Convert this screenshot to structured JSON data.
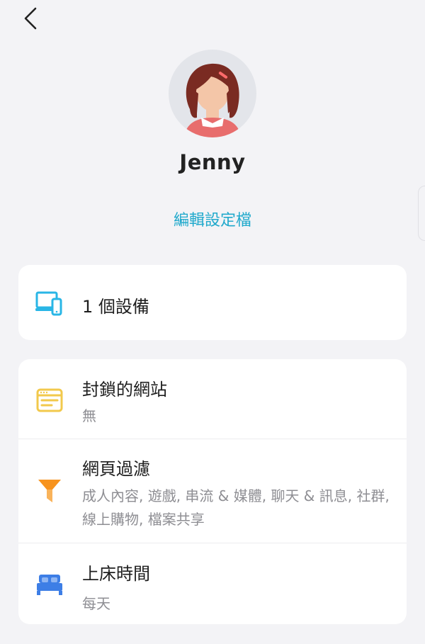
{
  "header": {
    "back_icon": "chevron-left-icon"
  },
  "profile": {
    "name": "Jenny",
    "avatar": "girl-avatar",
    "edit_label": "編輯設定檔"
  },
  "devices": {
    "icon": "devices-icon",
    "label": "1 個設備"
  },
  "settings": [
    {
      "icon": "blocked-sites-icon",
      "title": "封鎖的網站",
      "subtitle": "無"
    },
    {
      "icon": "filter-icon",
      "title": "網頁過濾",
      "subtitle": "成人內容, 遊戲, 串流 & 媒體, 聊天 & 訊息, 社群, 線上購物, 檔案共享"
    },
    {
      "icon": "bed-icon",
      "title": "上床時間",
      "subtitle": "每天"
    }
  ],
  "colors": {
    "accent": "#20a9cc",
    "background": "#f3f3f6",
    "devices_icon": "#29b6e6",
    "blocked_icon": "#f2c94c",
    "filter_icon": "#f7931e",
    "bed_icon": "#3d7ee6"
  }
}
